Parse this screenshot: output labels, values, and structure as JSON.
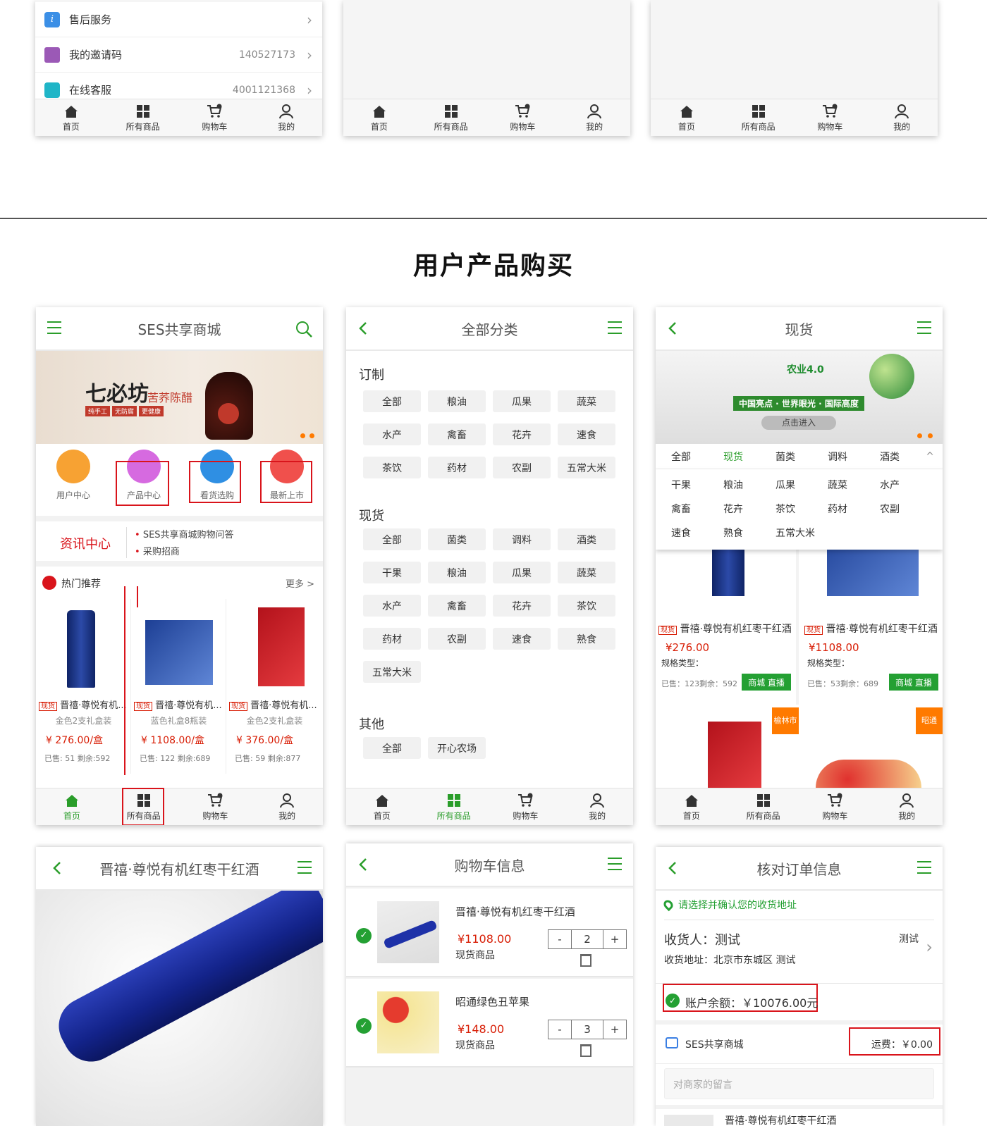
{
  "top_phone": {
    "rows": [
      {
        "label": "售后服务",
        "value": ""
      },
      {
        "label": "我的邀请码",
        "value": "140527173"
      },
      {
        "label": "在线客服",
        "value": "4001121368"
      }
    ]
  },
  "tabs": [
    "首页",
    "所有商品",
    "购物车",
    "我的"
  ],
  "section_title": "用户产品购买",
  "home": {
    "title": "SES共享商城",
    "banner_brand": "七必坊",
    "banner_sub": "苦荞陈醋",
    "banner_tags": [
      "纯手工",
      "无防腐",
      "更健康"
    ],
    "icons": [
      "用户中心",
      "产品中心",
      "看货选购",
      "最新上市"
    ],
    "news_logo": "资讯中心",
    "news": [
      "SES共享商城购物问答",
      "采购招商"
    ],
    "hot_label": "热门推荐",
    "more": "更多 >",
    "products": [
      {
        "tag": "现货",
        "name": "晋禧·尊悦有机...",
        "spec": "金色2支礼盒装",
        "price": "¥ 276.00/盒",
        "sold": "已售: 51 剩余:592"
      },
      {
        "tag": "现货",
        "name": "晋禧·尊悦有机...",
        "spec": "蓝色礼盒8瓶装",
        "price": "¥ 1108.00/盒",
        "sold": "已售: 122 剩余:689"
      },
      {
        "tag": "现货",
        "name": "晋禧·尊悦有机...",
        "spec": "金色2支礼盒装",
        "price": "¥ 376.00/盒",
        "sold": "已售: 59 剩余:877"
      }
    ]
  },
  "category": {
    "title": "全部分类",
    "groups": [
      {
        "name": "订制",
        "items": [
          "全部",
          "粮油",
          "瓜果",
          "蔬菜",
          "水产",
          "禽畜",
          "花卉",
          "速食",
          "茶饮",
          "药材",
          "农副",
          "五常大米"
        ]
      },
      {
        "name": "现货",
        "items": [
          "全部",
          "菌类",
          "调料",
          "酒类",
          "干果",
          "粮油",
          "瓜果",
          "蔬菜",
          "水产",
          "禽畜",
          "花卉",
          "茶饮",
          "药材",
          "农副",
          "速食",
          "熟食",
          "五常大米"
        ]
      },
      {
        "name": "其他",
        "items": [
          "全部",
          "开心农场"
        ]
      }
    ]
  },
  "spot": {
    "title": "现货",
    "banner_logo": "农业4.0",
    "banner_slogan": "中国亮点 · 世界眼光 · 国际高度",
    "banner_btn": "点击进入",
    "filter_tabs": [
      "全部",
      "现货",
      "菌类",
      "调料",
      "酒类"
    ],
    "filter_items": [
      "干果",
      "粮油",
      "瓜果",
      "蔬菜",
      "水产",
      "禽畜",
      "花卉",
      "茶饮",
      "药材",
      "农副",
      "速食",
      "熟食",
      "五常大米"
    ],
    "products": [
      {
        "tag": "现货",
        "name": "晋禧·尊悦有机红枣干红酒",
        "price": "¥276.00",
        "spec": "规格类型：",
        "sold": "已售：123剩余：592",
        "btn": "商城 直播"
      },
      {
        "tag": "现货",
        "name": "晋禧·尊悦有机红枣干红酒",
        "price": "¥1108.00",
        "spec": "规格类型：",
        "sold": "已售：53剩余：689",
        "btn": "商城 直播"
      }
    ],
    "badges": [
      "榆林市",
      "昭通"
    ]
  },
  "detail": {
    "title": "晋禧·尊悦有机红枣干红酒"
  },
  "cart": {
    "title": "购物车信息",
    "items": [
      {
        "name": "晋禧·尊悦有机红枣干红酒",
        "price": "¥1108.00",
        "type": "现货商品",
        "qty": "2"
      },
      {
        "name": "昭通绿色丑苹果",
        "price": "¥148.00",
        "type": "现货商品",
        "qty": "3"
      }
    ]
  },
  "order": {
    "title": "核对订单信息",
    "addr_hint": "请选择并确认您的收货地址",
    "receiver": "收货人：测试",
    "receiver_tag": "测试",
    "address": "收货地址：北京市东城区 测试",
    "balance": "账户余额：￥10076.00元",
    "shop": "SES共享商城",
    "freight": "运费：￥0.00",
    "msg_placeholder": "对商家的留言",
    "item_name": "晋禧·尊悦有机红枣干红酒"
  }
}
